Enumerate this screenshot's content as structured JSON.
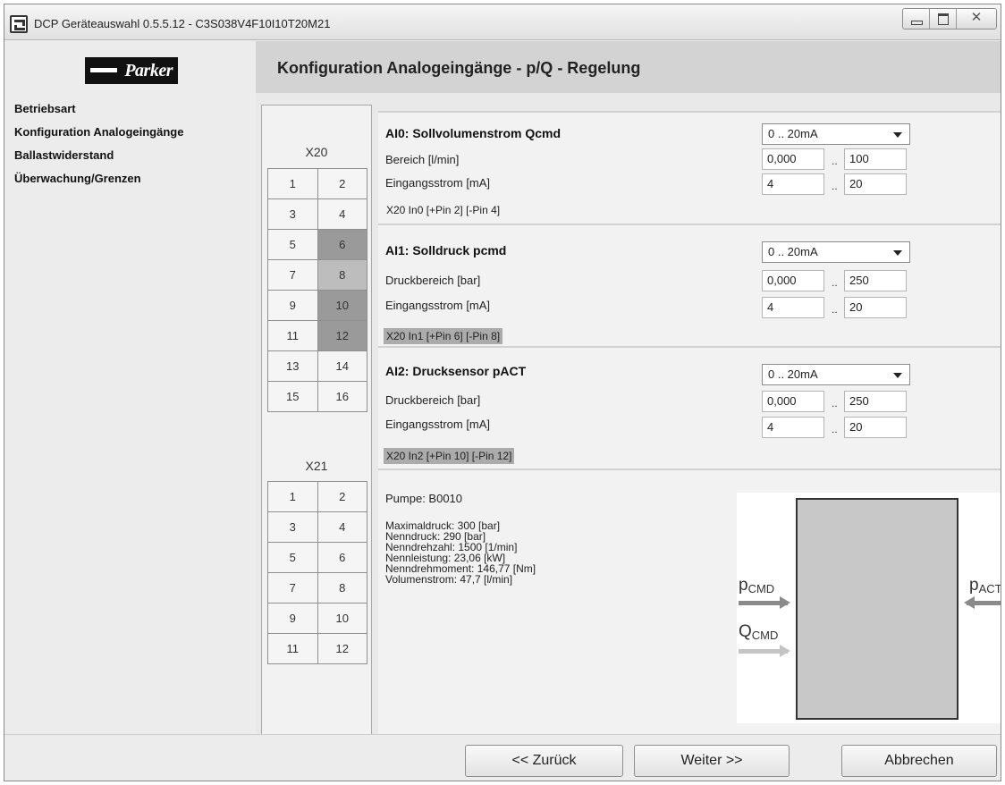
{
  "window": {
    "title": "DCP Geräteauswahl 0.5.5.12 - C3S038V4F10I10T20M21",
    "close_glyph": "✕"
  },
  "sidebar": {
    "logo_text": "Parker",
    "items": [
      {
        "label": "Betriebsart"
      },
      {
        "label": "Konfiguration Analogeingänge"
      },
      {
        "label": "Ballastwiderstand"
      },
      {
        "label": "Überwachung/Grenzen"
      }
    ]
  },
  "header": {
    "title": "Konfiguration Analogeingänge - p/Q -  Regelung"
  },
  "pins": {
    "x20": {
      "label": "X20",
      "rows": [
        [
          "1",
          "2"
        ],
        [
          "3",
          "4"
        ],
        [
          "5",
          "6"
        ],
        [
          "7",
          "8"
        ],
        [
          "9",
          "10"
        ],
        [
          "11",
          "12"
        ],
        [
          "13",
          "14"
        ],
        [
          "15",
          "16"
        ]
      ]
    },
    "x21": {
      "label": "X21",
      "rows": [
        [
          "1",
          "2"
        ],
        [
          "3",
          "4"
        ],
        [
          "5",
          "6"
        ],
        [
          "7",
          "8"
        ],
        [
          "9",
          "10"
        ],
        [
          "11",
          "12"
        ]
      ]
    }
  },
  "inputs": [
    {
      "title": "AI0: Sollvolumenstrom Qcmd",
      "mode": "0 .. 20mA",
      "range_label": "Bereich [l/min]",
      "range_min": "0,000",
      "range_max": "100",
      "current_label": "Eingangsstrom [mA]",
      "current_min": "4",
      "current_max": "20",
      "pins": "X20  In0  [+Pin 2]  [-Pin 4]",
      "separator": ".."
    },
    {
      "title": "AI1: Solldruck pcmd",
      "mode": "0 .. 20mA",
      "range_label": "Druckbereich [bar]",
      "range_min": "0,000",
      "range_max": "250",
      "current_label": "Eingangsstrom [mA]",
      "current_min": "4",
      "current_max": "20",
      "pins": "X20  In1  [+Pin 6]  [-Pin 8]",
      "separator": ".."
    },
    {
      "title": "AI2: Drucksensor pACT",
      "mode": "0 .. 20mA",
      "range_label": "Druckbereich [bar]",
      "range_min": "0,000",
      "range_max": "250",
      "current_label": "Eingangsstrom [mA]",
      "current_min": "4",
      "current_max": "20",
      "pins": "X20  In2  [+Pin 10]  [-Pin 12]",
      "separator": ".."
    }
  ],
  "pump": {
    "name": "Pumpe: B0010",
    "specs": [
      "Maximaldruck: 300 [bar]",
      "Nenndruck: 290 [bar]",
      "Nenndrehzahl: 1500 [1/min]",
      "Nennleistung: 23,06 [kW]",
      "Nenndrehmoment: 146,77 [Nm]",
      "Volumenstrom: 47,7 [l/min]"
    ]
  },
  "diagram": {
    "p_cmd": {
      "main": "p",
      "sub": "CMD"
    },
    "q_cmd": {
      "main": "Q",
      "sub": "CMD"
    },
    "p_act": {
      "main": "p",
      "sub": "ACT"
    }
  },
  "footer": {
    "back_label": "<< Zurück",
    "next_label": "Weiter >>",
    "cancel_label": "Abbrechen"
  }
}
